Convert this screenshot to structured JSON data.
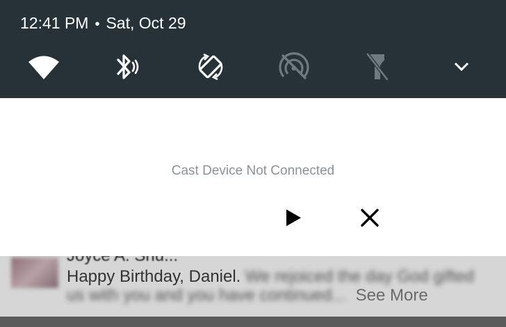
{
  "status_bar": {
    "time": "12:41 PM",
    "separator": "•",
    "date": "Sat, Oct 29"
  },
  "quick_settings": {
    "tiles": [
      {
        "icon": "wifi-icon",
        "active": true
      },
      {
        "icon": "bluetooth-icon",
        "active": true
      },
      {
        "icon": "auto-rotate-icon",
        "active": true
      },
      {
        "icon": "hotspot-off-icon",
        "active": false
      },
      {
        "icon": "flashlight-off-icon",
        "active": false
      }
    ],
    "expand_icon": "chevron-down-icon",
    "colors": {
      "active": "#ffffff",
      "inactive": "#6e7a80",
      "background": "#263238"
    }
  },
  "cast_notification": {
    "status": "Cast Device Not Connected",
    "play_icon": "play-icon",
    "close_icon": "close-icon"
  },
  "message_notification": {
    "sender": "Joyce A. Shu...",
    "text_visible": "Happy Birthday, Daniel.",
    "text_blurred_1": "We rejoiced the day God gifted",
    "text_blurred_2": "us with you and you have continued...",
    "see_more": "See More"
  }
}
